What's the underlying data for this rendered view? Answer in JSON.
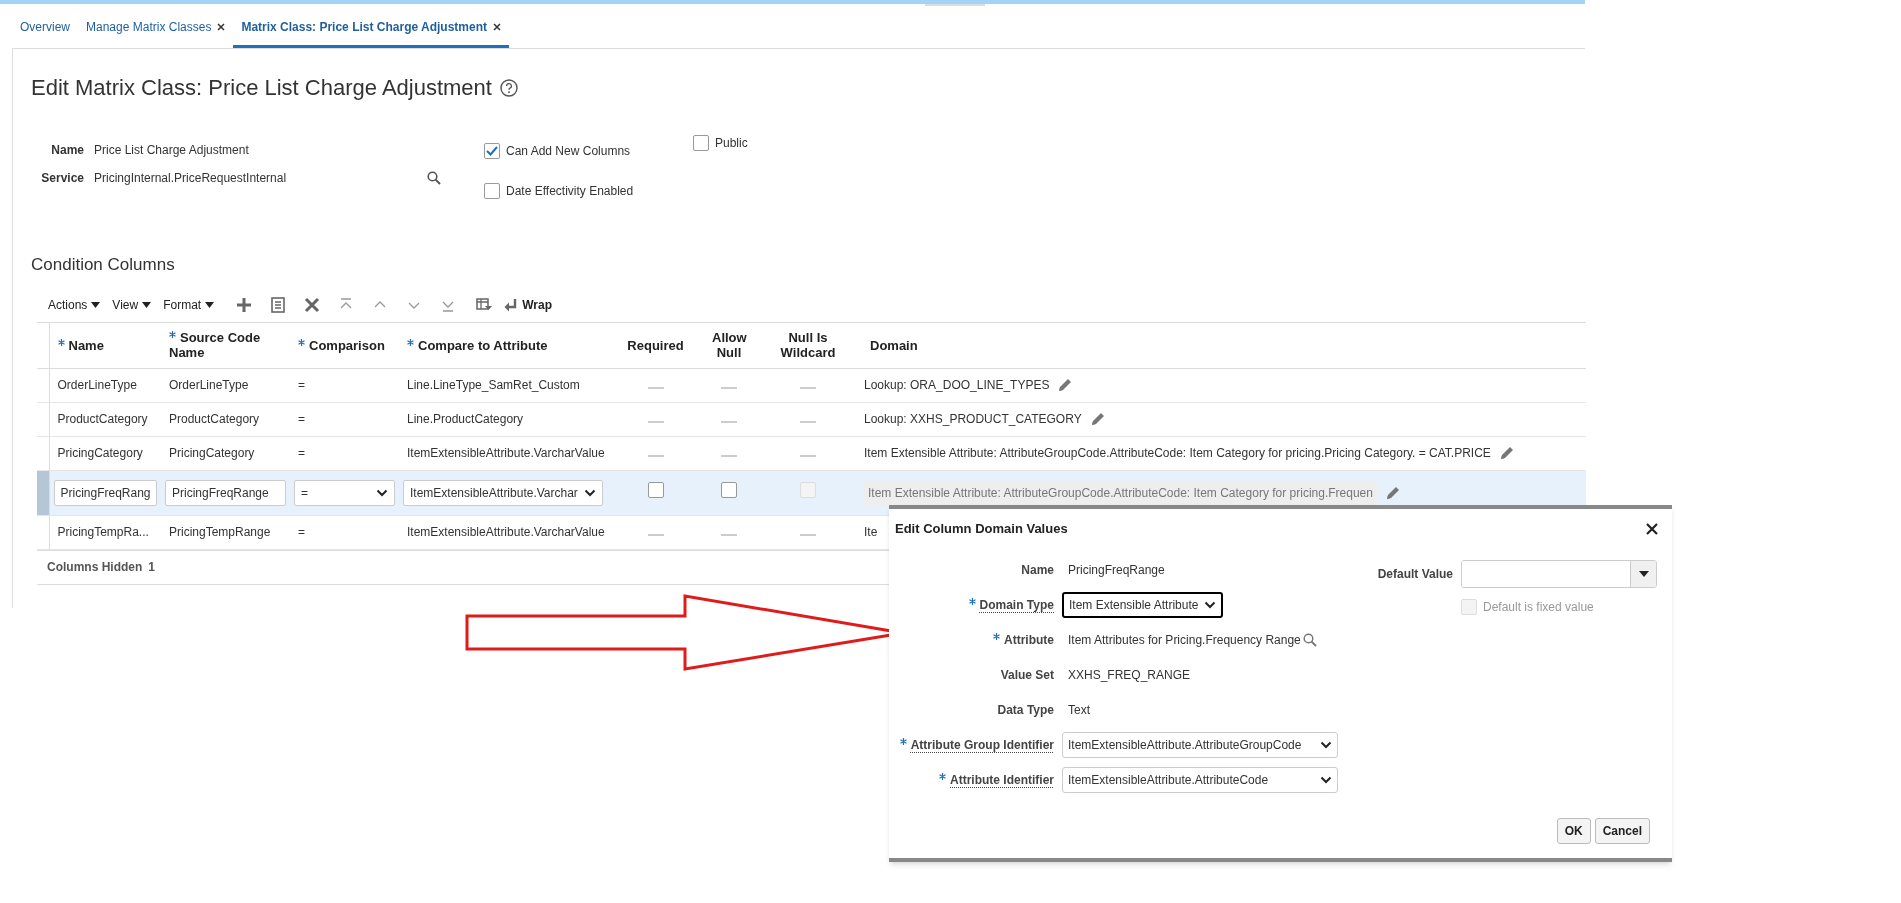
{
  "tabs": [
    {
      "label": "Overview",
      "closable": false,
      "selected": false
    },
    {
      "label": "Manage Matrix Classes",
      "closable": true,
      "selected": false
    },
    {
      "label": "Matrix Class: Price List Charge Adjustment",
      "closable": true,
      "selected": true
    }
  ],
  "page_title": "Edit Matrix Class: Price List Charge Adjustment",
  "form": {
    "fields": [
      {
        "label": "Name",
        "value": "Price List Charge Adjustment",
        "kind": "text"
      },
      {
        "label": "Service",
        "value": "PricingInternal.PriceRequestInternal",
        "kind": "lookup"
      }
    ],
    "checkboxes": [
      {
        "label": "Can Add New Columns",
        "checked": true
      },
      {
        "label": "Date Effectivity Enabled",
        "checked": false
      },
      {
        "label": "Public",
        "checked": false
      }
    ]
  },
  "section_title": "Condition Columns",
  "toolbar": {
    "menus": [
      "Actions",
      "View",
      "Format"
    ],
    "wrap_label": "Wrap"
  },
  "table": {
    "columns": [
      {
        "label": "Name",
        "required": true,
        "kind": "text"
      },
      {
        "label": "Source Code Name",
        "required": true,
        "kind": "text"
      },
      {
        "label": "Comparison",
        "required": true,
        "kind": "text"
      },
      {
        "label": "Compare to Attribute",
        "required": true,
        "kind": "text"
      },
      {
        "label": "Required",
        "required": false,
        "kind": "boolean"
      },
      {
        "label": "Allow Null",
        "required": false,
        "kind": "boolean"
      },
      {
        "label": "Null Is Wildcard",
        "required": false,
        "kind": "boolean"
      },
      {
        "label": "Domain",
        "required": false,
        "kind": "text"
      }
    ],
    "rows": [
      {
        "kind": "read",
        "selected": false,
        "name": "OrderLineType",
        "source_code_name": "OrderLineType",
        "comparison": "=",
        "compare_to_attribute": "Line.LineType_SamRet_Custom",
        "required": false,
        "allow_null": false,
        "null_is_wildcard": false,
        "domain": "Lookup: ORA_DOO_LINE_TYPES",
        "editable_domain": true
      },
      {
        "kind": "read",
        "selected": false,
        "name": "ProductCategory",
        "source_code_name": "ProductCategory",
        "comparison": "=",
        "compare_to_attribute": "Line.ProductCategory",
        "required": false,
        "allow_null": false,
        "null_is_wildcard": false,
        "domain": "Lookup: XXHS_PRODUCT_CATEGORY",
        "editable_domain": true
      },
      {
        "kind": "read",
        "selected": false,
        "name": "PricingCategory",
        "source_code_name": "PricingCategory",
        "comparison": "=",
        "compare_to_attribute": "ItemExtensibleAttribute.VarcharValue",
        "required": false,
        "allow_null": false,
        "null_is_wildcard": false,
        "domain": "Item Extensible Attribute: AttributeGroupCode.AttributeCode: Item Category for pricing.Pricing Category. = CAT.PRICE",
        "editable_domain": true
      },
      {
        "kind": "edit",
        "selected": true,
        "name": "PricingFreqRang",
        "source_code_name": "PricingFreqRange",
        "comparison": "=",
        "compare_to_attribute": "ItemExtensibleAttribute.Varchar",
        "required": false,
        "allow_null": false,
        "null_is_wildcard": false,
        "null_is_wildcard_disabled": true,
        "domain": "Item Extensible Attribute: AttributeGroupCode.AttributeCode: Item Category for pricing.Frequen",
        "editable_domain": true
      },
      {
        "kind": "read",
        "selected": false,
        "name": "PricingTempRa...",
        "source_code_name": "PricingTempRange",
        "comparison": "=",
        "compare_to_attribute": "ItemExtensibleAttribute.VarcharValue",
        "required": false,
        "allow_null": false,
        "null_is_wildcard": false,
        "domain": "Ite",
        "editable_domain": false
      }
    ],
    "footer": {
      "label": "Columns Hidden",
      "count": "1"
    }
  },
  "dialog": {
    "title": "Edit Column Domain Values",
    "fields": [
      {
        "label": "Name",
        "required": false,
        "kind": "text",
        "value": "PricingFreqRange"
      },
      {
        "label": "Domain Type",
        "required": true,
        "kind": "select",
        "value": "Item Extensible Attribute",
        "focused": true
      },
      {
        "label": "Attribute",
        "required": true,
        "kind": "lookup",
        "value": "Item Attributes for Pricing.Frequency Range"
      },
      {
        "label": "Value Set",
        "required": false,
        "kind": "text",
        "value": "XXHS_FREQ_RANGE"
      },
      {
        "label": "Data Type",
        "required": false,
        "kind": "text",
        "value": "Text"
      },
      {
        "label": "Attribute Group Identifier",
        "required": true,
        "kind": "select",
        "value": "ItemExtensibleAttribute.AttributeGroupCode",
        "focused": false
      },
      {
        "label": "Attribute Identifier",
        "required": true,
        "kind": "select",
        "value": "ItemExtensibleAttribute.AttributeCode",
        "focused": false
      }
    ],
    "default_value": {
      "label": "Default Value"
    },
    "default_fixed": {
      "label": "Default is fixed value",
      "checked": false,
      "disabled": true
    },
    "buttons": [
      "OK",
      "Cancel"
    ]
  }
}
